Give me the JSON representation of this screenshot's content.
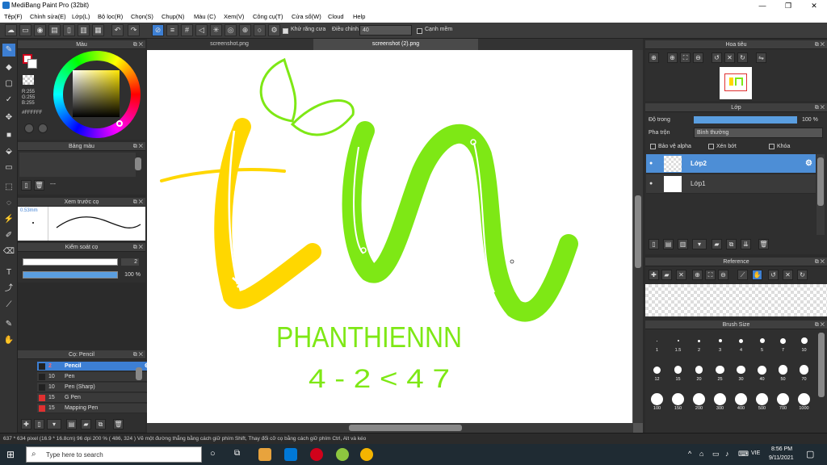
{
  "window": {
    "title": "MediBang Paint Pro (32bit)",
    "minimize": "—",
    "maximize": "❐",
    "close": "✕"
  },
  "menu": [
    "Tệp(F)",
    "Chỉnh sửa(E)",
    "Lớp(L)",
    "Bộ lọc(R)",
    "Chọn(S)",
    "Chụp(N)",
    "Màu (C)",
    "Xem(V)",
    "Công cụ(T)",
    "Cửa sổ(W)",
    "Cloud",
    "Help"
  ],
  "toolbar": {
    "antialias_label": "Khử răng cưa",
    "adjust_label": "Điều chỉnh",
    "adjust_value": "40",
    "edge_label": "Cạnh mềm"
  },
  "tabs": [
    "screenshot.png",
    "screenshot (2).png"
  ],
  "color_panel": {
    "title": "Màu",
    "values": [
      "R:255",
      "G:255",
      "B:255"
    ],
    "hex": "#FFFFFF",
    "primary_color": "#d0021b",
    "secondary_color": "#ffffff"
  },
  "palette_panel": {
    "title": "Bảng màu",
    "dash": "---"
  },
  "preview_panel": {
    "title": "Xem trước cọ",
    "size": "0.53mm"
  },
  "brush_control": {
    "title": "Kiểm soát cọ",
    "size_value": "2",
    "opacity_value": "100 %"
  },
  "brush_panel": {
    "title": "Cọ: Pencil",
    "items": [
      {
        "size": "2",
        "name": "Pencil",
        "color": "#222222"
      },
      {
        "size": "10",
        "name": "Pen",
        "color": "#222222"
      },
      {
        "size": "10",
        "name": "Pen (Sharp)",
        "color": "#222222"
      },
      {
        "size": "15",
        "name": "G Pen",
        "color": "#e03030"
      },
      {
        "size": "15",
        "name": "Mapping Pen",
        "color": "#e03030"
      }
    ]
  },
  "navigator": {
    "title": "Hoa tiêu"
  },
  "layer_panel": {
    "title": "Lớp",
    "opacity_label": "Độ trong",
    "opacity_value": "100 %",
    "blend_label": "Pha trộn",
    "blend_value": "Bình thường",
    "protect_alpha": "Bảo vệ alpha",
    "clipping": "Xén bớt",
    "lock": "Khóa",
    "layers": [
      {
        "name": "Lớp2",
        "selected": true
      },
      {
        "name": "Lớp1",
        "selected": false
      }
    ]
  },
  "reference_panel": {
    "title": "Reference"
  },
  "brush_size_panel": {
    "title": "Brush Size",
    "sizes": [
      "1",
      "1.5",
      "2",
      "3",
      "4",
      "5",
      "7",
      "10",
      "12",
      "15",
      "20",
      "25",
      "30",
      "40",
      "50",
      "70",
      "100",
      "150",
      "200",
      "300",
      "400",
      "500",
      "700",
      "1000"
    ]
  },
  "status": "637 * 634 pixel   (16.9 * 16.8cm)   96 dpi   200 %   ( 486, 324 )   Vẽ một đường thẳng bằng cách giữ phím Shift, Thay đổi cỡ cọ bằng cách giữ phím Ctrl, Alt và kéo",
  "taskbar": {
    "search_placeholder": "Type here to search",
    "time": "8:56 PM",
    "date": "9/11/2021",
    "lang": "VIE"
  },
  "drawing_text": {
    "line1": "PHANTHIENNN",
    "line2": "4 - 2 < 4 7"
  },
  "colors": {
    "accent": "#3d7fd3",
    "yellow_stroke": "#ffd700",
    "green_stroke": "#7ee815"
  }
}
